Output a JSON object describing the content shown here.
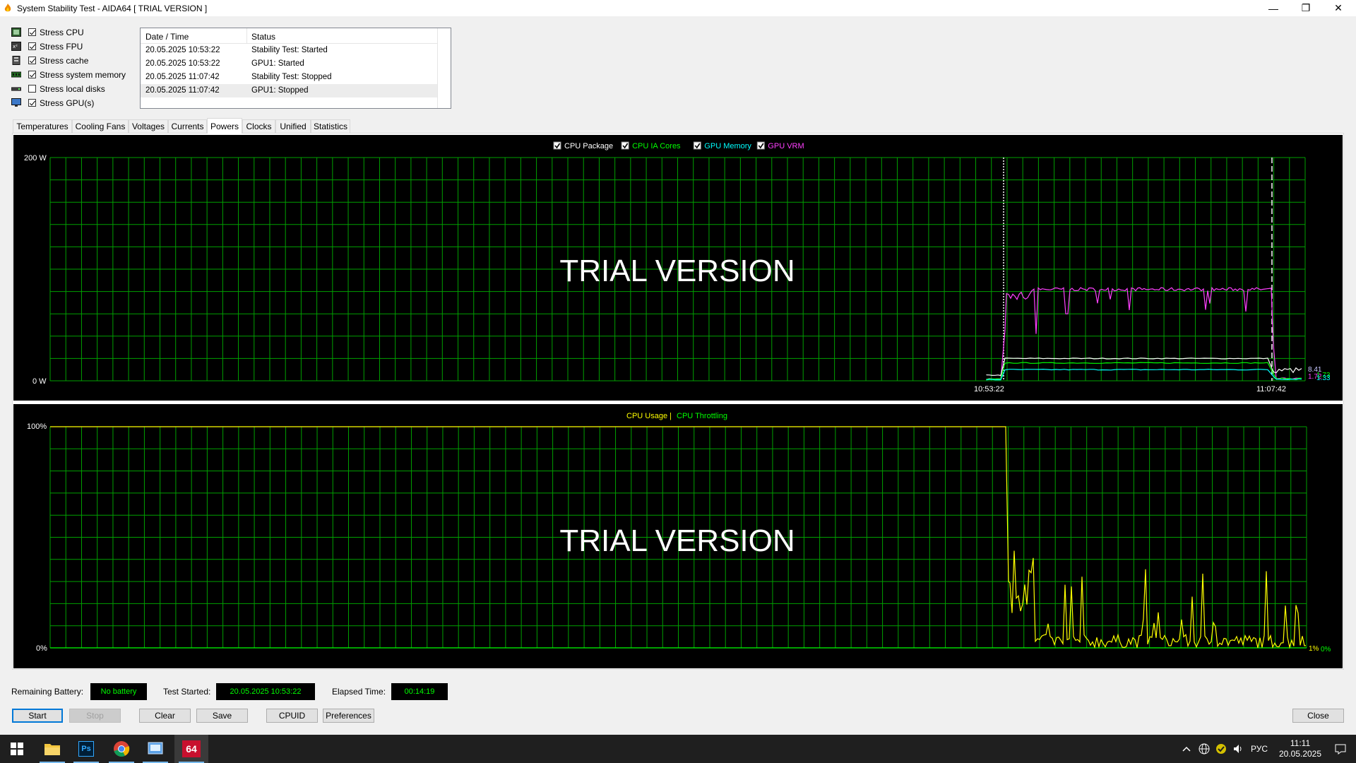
{
  "window": {
    "title": "System Stability Test - AIDA64  [ TRIAL VERSION ]",
    "minimize_glyph": "—",
    "restore_glyph": "❐",
    "close_glyph": "✕"
  },
  "stress_options": [
    {
      "label": "Stress CPU",
      "checked": true,
      "icon": "cpu-chip-icon"
    },
    {
      "label": "Stress FPU",
      "checked": true,
      "icon": "fpu-chip-icon"
    },
    {
      "label": "Stress cache",
      "checked": true,
      "icon": "cache-icon"
    },
    {
      "label": "Stress system memory",
      "checked": true,
      "icon": "memory-module-icon"
    },
    {
      "label": "Stress local disks",
      "checked": false,
      "icon": "disk-drive-icon"
    },
    {
      "label": "Stress GPU(s)",
      "checked": true,
      "icon": "gpu-monitor-icon"
    }
  ],
  "log": {
    "col_time": "Date / Time",
    "col_status": "Status",
    "rows": [
      {
        "time": "20.05.2025 10:53:22",
        "status": "Stability Test: Started"
      },
      {
        "time": "20.05.2025 10:53:22",
        "status": "GPU1: Started"
      },
      {
        "time": "20.05.2025 11:07:42",
        "status": "Stability Test: Stopped"
      },
      {
        "time": "20.05.2025 11:07:42",
        "status": "GPU1: Stopped"
      }
    ]
  },
  "tabs": [
    "Temperatures",
    "Cooling Fans",
    "Voltages",
    "Currents",
    "Powers",
    "Clocks",
    "Unified",
    "Statistics"
  ],
  "active_tab": "Powers",
  "chart_data": [
    {
      "type": "line",
      "ylim": [
        0,
        200
      ],
      "y_top_label": "200 W",
      "y_bottom_label": "0 W",
      "watermark": "TRIAL VERSION",
      "markers": [
        "10:53:22",
        "11:07:42"
      ],
      "legend": [
        {
          "name": "CPU Package",
          "color": "#ffffff",
          "checked": true
        },
        {
          "name": "CPU IA Cores",
          "color": "#00ff00",
          "checked": true
        },
        {
          "name": "GPU Memory",
          "color": "#00ffff",
          "checked": true
        },
        {
          "name": "GPU VRM",
          "color": "#ff40ff",
          "checked": true
        }
      ],
      "end_labels": [
        {
          "text": "8.41",
          "color": "#c8c8ff"
        },
        {
          "text": "1.72",
          "color": "#ff40ff"
        },
        {
          "text": "1.73",
          "color": "#00ff00"
        },
        {
          "text": "1.33",
          "color": "#00ffff"
        }
      ],
      "series": [
        {
          "name": "GPU VRM",
          "color": "#ff40ff",
          "start_idle": 1.7,
          "load_level": 82,
          "load_min_dip": 42,
          "end_idle": 1.72
        },
        {
          "name": "CPU Package",
          "color": "#ffffff",
          "start_idle": 5,
          "load_level": 20,
          "end_idle": 8.41
        },
        {
          "name": "CPU IA Cores",
          "color": "#00ff00",
          "start_idle": 1.5,
          "load_level": 16,
          "end_idle": 1.73
        },
        {
          "name": "GPU Memory",
          "color": "#00ffff",
          "start_idle": 1.0,
          "load_level": 10,
          "end_idle": 1.33
        }
      ]
    },
    {
      "type": "line",
      "ylim": [
        0,
        100
      ],
      "y_top_label": "100%",
      "y_bottom_label": "0%",
      "watermark": "TRIAL VERSION",
      "legend": [
        {
          "name": "CPU Usage",
          "color": "#ffff00"
        },
        {
          "name": "CPU Throttling",
          "color": "#00ff00"
        }
      ],
      "legend_sep": "|",
      "end_labels": [
        {
          "text": "1%",
          "color": "#ffff00"
        },
        {
          "text": "0%",
          "color": "#00ff00"
        }
      ],
      "series": [
        {
          "name": "CPU Usage",
          "color": "#ffff00",
          "load_level": 100,
          "end_value": 1
        },
        {
          "name": "CPU Throttling",
          "color": "#00ff00",
          "end_value": 0
        }
      ]
    }
  ],
  "status": {
    "battery_label": "Remaining Battery:",
    "battery_value": "No battery",
    "started_label": "Test Started:",
    "started_value": "20.05.2025 10:53:22",
    "elapsed_label": "Elapsed Time:",
    "elapsed_value": "00:14:19"
  },
  "buttons": {
    "start": "Start",
    "stop": "Stop",
    "clear": "Clear",
    "save": "Save",
    "cpuid": "CPUID",
    "preferences": "Preferences",
    "close": "Close"
  },
  "taskbar": {
    "aida_label": "64",
    "ps_label": "Ps",
    "lang": "РУС",
    "time": "11:11",
    "date": "20.05.2025"
  },
  "colors": {
    "grid": "#00a000",
    "chart_bg": "#000000",
    "field_text": "#00ff00",
    "accent": "#0078d7"
  }
}
